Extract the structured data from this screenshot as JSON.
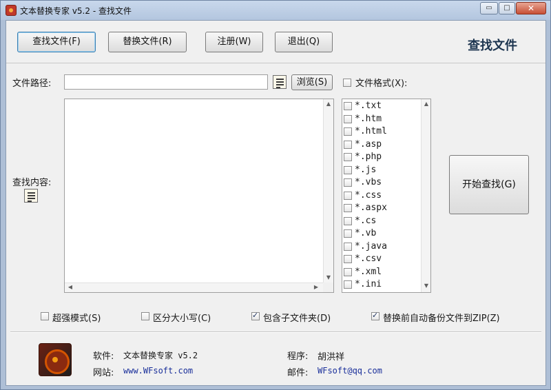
{
  "window": {
    "title": "文本替换专家 v5.2 - 查找文件",
    "min_glyph": "▭",
    "max_glyph": "□",
    "close_glyph": "✕"
  },
  "toolbar": {
    "find_label": "查找文件(F)",
    "replace_label": "替换文件(R)",
    "register_label": "注册(W)",
    "exit_label": "退出(Q)",
    "mode_title": "查找文件"
  },
  "form": {
    "path_label": "文件路径:",
    "path_value": "",
    "browse_label": "浏览(S)",
    "format_label": "文件格式(X):",
    "format_checked": false,
    "content_label": "查找内容:",
    "content_value": ""
  },
  "formats": [
    {
      "ext": "*.txt",
      "checked": false
    },
    {
      "ext": "*.htm",
      "checked": false
    },
    {
      "ext": "*.html",
      "checked": false
    },
    {
      "ext": "*.asp",
      "checked": false
    },
    {
      "ext": "*.php",
      "checked": false
    },
    {
      "ext": "*.js",
      "checked": false
    },
    {
      "ext": "*.vbs",
      "checked": false
    },
    {
      "ext": "*.css",
      "checked": false
    },
    {
      "ext": "*.aspx",
      "checked": false
    },
    {
      "ext": "*.cs",
      "checked": false
    },
    {
      "ext": "*.vb",
      "checked": false
    },
    {
      "ext": "*.java",
      "checked": false
    },
    {
      "ext": "*.csv",
      "checked": false
    },
    {
      "ext": "*.xml",
      "checked": false
    },
    {
      "ext": "*.ini",
      "checked": false
    }
  ],
  "start_label": "开始查找(G)",
  "options": {
    "strong_label": "超强模式(S)",
    "strong_checked": false,
    "case_label": "区分大小写(C)",
    "case_checked": false,
    "subfolder_label": "包含子文件夹(D)",
    "subfolder_checked": true,
    "backup_label": "替换前自动备份文件到ZIP(Z)",
    "backup_checked": true
  },
  "footer": {
    "software_label": "软件:",
    "software_value": "文本替换专家 v5.2",
    "website_label": "网站:",
    "website_value": "www.WFsoft.com",
    "author_label": "程序:",
    "author_value": "胡洪祥",
    "email_label": "邮件:",
    "email_value": "WFsoft@qq.com"
  },
  "colors": {
    "window_frame": "#aebfd6",
    "client_bg": "#f0f0f0",
    "title_accent": "#1d3550",
    "link": "#1a2f9a"
  }
}
